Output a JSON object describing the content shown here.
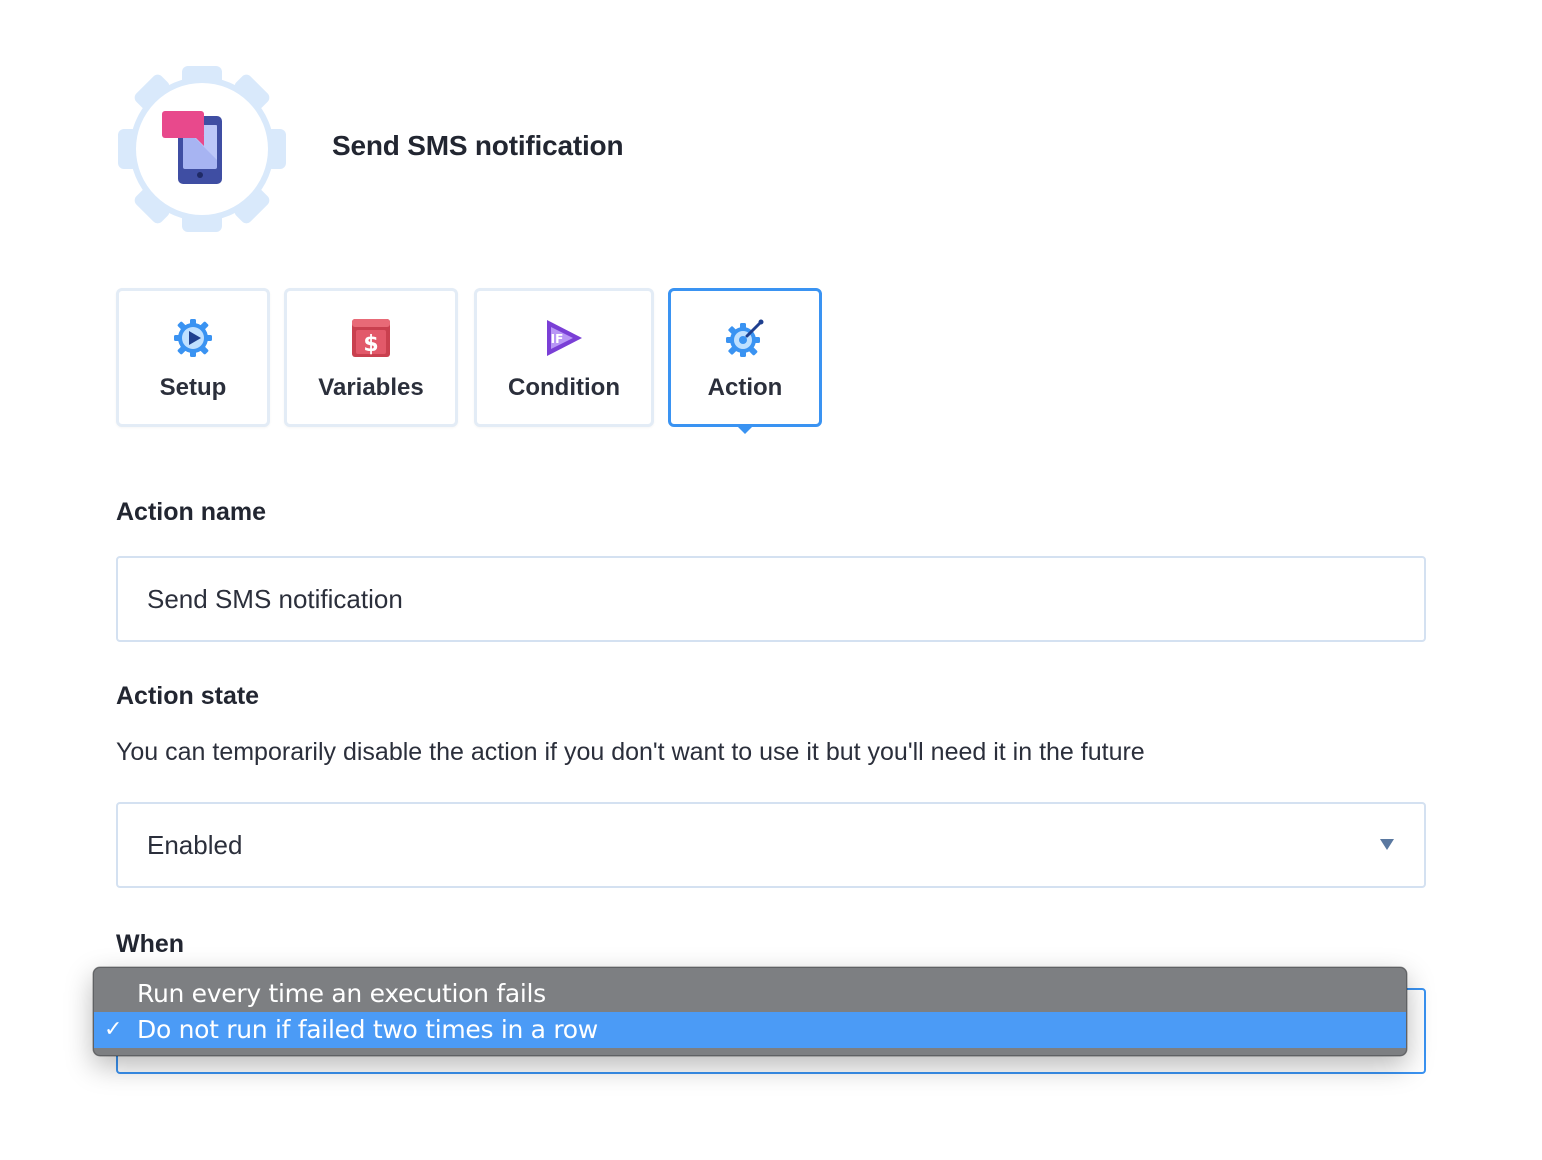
{
  "header": {
    "title": "Send SMS notification",
    "icon": "sms-phone-gear-icon"
  },
  "tabs": [
    {
      "label": "Setup",
      "icon": "play-gear-icon"
    },
    {
      "label": "Variables",
      "icon": "dollar-icon"
    },
    {
      "label": "Condition",
      "icon": "if-play-icon"
    },
    {
      "label": "Action",
      "icon": "action-gear-icon",
      "active": true
    }
  ],
  "form": {
    "action_name": {
      "label": "Action name",
      "value": "Send SMS notification"
    },
    "action_state": {
      "label": "Action state",
      "help": "You can temporarily disable the action if you don't want to use it but you'll need it in the future",
      "value": "Enabled"
    },
    "when": {
      "label": "When",
      "options": [
        {
          "label": "Run every time an execution fails",
          "selected": false
        },
        {
          "label": "Do not run if failed two times in a row",
          "selected": true
        }
      ],
      "check_mark": "✓"
    }
  },
  "colors": {
    "accent": "#3a93f2",
    "menu_bg": "#7d7f82",
    "menu_selected": "#4b9bf6",
    "border": "#d4e1f1"
  }
}
